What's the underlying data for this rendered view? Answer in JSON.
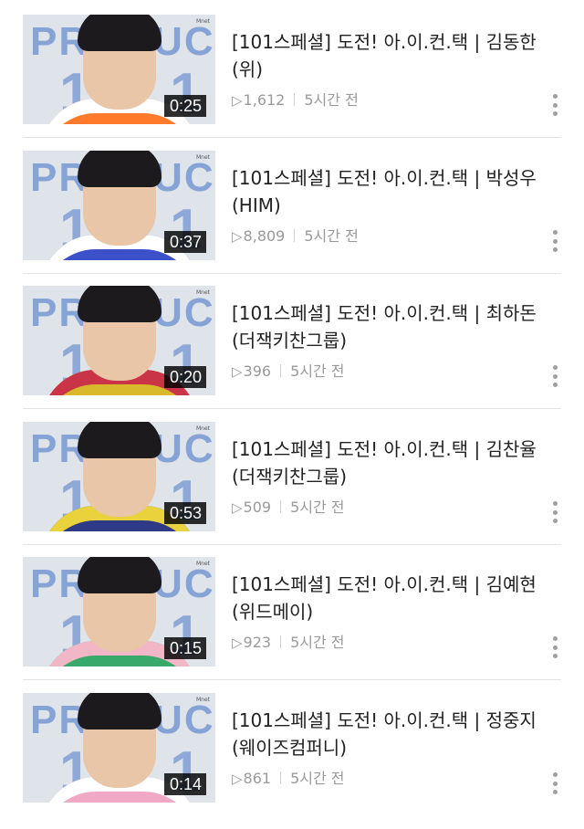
{
  "videos": [
    {
      "title": "[101스페셜] 도전! 아.이.컨.택 | 김동한 (위)",
      "views": "1,612",
      "age": "5시간 전",
      "duration": "0:25",
      "shirt_color": "#ff7a2b",
      "trim_color": "#ffffff"
    },
    {
      "title": "[101스페셜] 도전! 아.이.컨.택 | 박성우 (HIM)",
      "views": "8,809",
      "age": "5시간 전",
      "duration": "0:37",
      "shirt_color": "#3b50c9",
      "trim_color": "#ffffff"
    },
    {
      "title": "[101스페셜] 도전! 아.이.컨.택 | 최하돈 (더잭키찬그룹)",
      "views": "396",
      "age": "5시간 전",
      "duration": "0:20",
      "shirt_color": "#d9b92c",
      "trim_color": "#c93446"
    },
    {
      "title": "[101스페셜] 도전! 아.이.컨.택 | 김찬율 (더잭키찬그룹)",
      "views": "509",
      "age": "5시간 전",
      "duration": "0:53",
      "shirt_color": "#2e3a86",
      "trim_color": "#e9d23b"
    },
    {
      "title": "[101스페셜] 도전! 아.이.컨.택 | 김예현 (위드메이)",
      "views": "923",
      "age": "5시간 전",
      "duration": "0:15",
      "shirt_color": "#39a86b",
      "trim_color": "#f2b7c7"
    },
    {
      "title": "[101스페셜] 도전! 아.이.컨.택 | 정중지 (웨이즈컴퍼니)",
      "views": "861",
      "age": "5시간 전",
      "duration": "0:14",
      "shirt_color": "#f0a9c4",
      "trim_color": "#ffffff"
    }
  ],
  "thumbnail": {
    "logo_text": "PRODUCE",
    "logo_number": "101",
    "channel_mark": "Mnet"
  },
  "icons": {
    "play": "play-triangle-icon",
    "more": "vertical-ellipsis-icon"
  }
}
